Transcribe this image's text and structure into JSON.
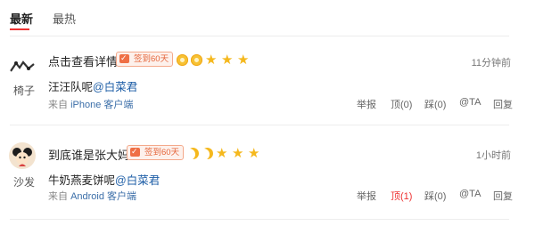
{
  "tabs": [
    {
      "label": "最新",
      "active": true
    },
    {
      "label": "最热",
      "active": false
    }
  ],
  "badge_color": "#e5653a",
  "posts": [
    {
      "floor": "椅子",
      "username": "点击查看详情",
      "badge": "签到60天",
      "level_icons": [
        "sun",
        "sun",
        "star",
        "star",
        "star"
      ],
      "time": "11分钟前",
      "content_text": "汪汪队呢",
      "mention": "@白菜君",
      "source_prefix": "来自",
      "source_device": "iPhone 客户端",
      "actions": {
        "report": "举报",
        "up": "顶(0)",
        "down": "踩(0)",
        "at": "@TA",
        "reply": "回复"
      }
    },
    {
      "floor": "沙发",
      "username": "到底谁是张大妈",
      "badge": "签到60天",
      "level_icons": [
        "moon",
        "moon",
        "star",
        "star",
        "star"
      ],
      "time": "1小时前",
      "content_text": "牛奶燕麦饼呢",
      "mention": "@白菜君",
      "source_prefix": "来自",
      "source_device": "Android 客户端",
      "actions": {
        "report": "举报",
        "up": "顶(1)",
        "down": "踩(0)",
        "at": "@TA",
        "reply": "回复"
      }
    }
  ]
}
